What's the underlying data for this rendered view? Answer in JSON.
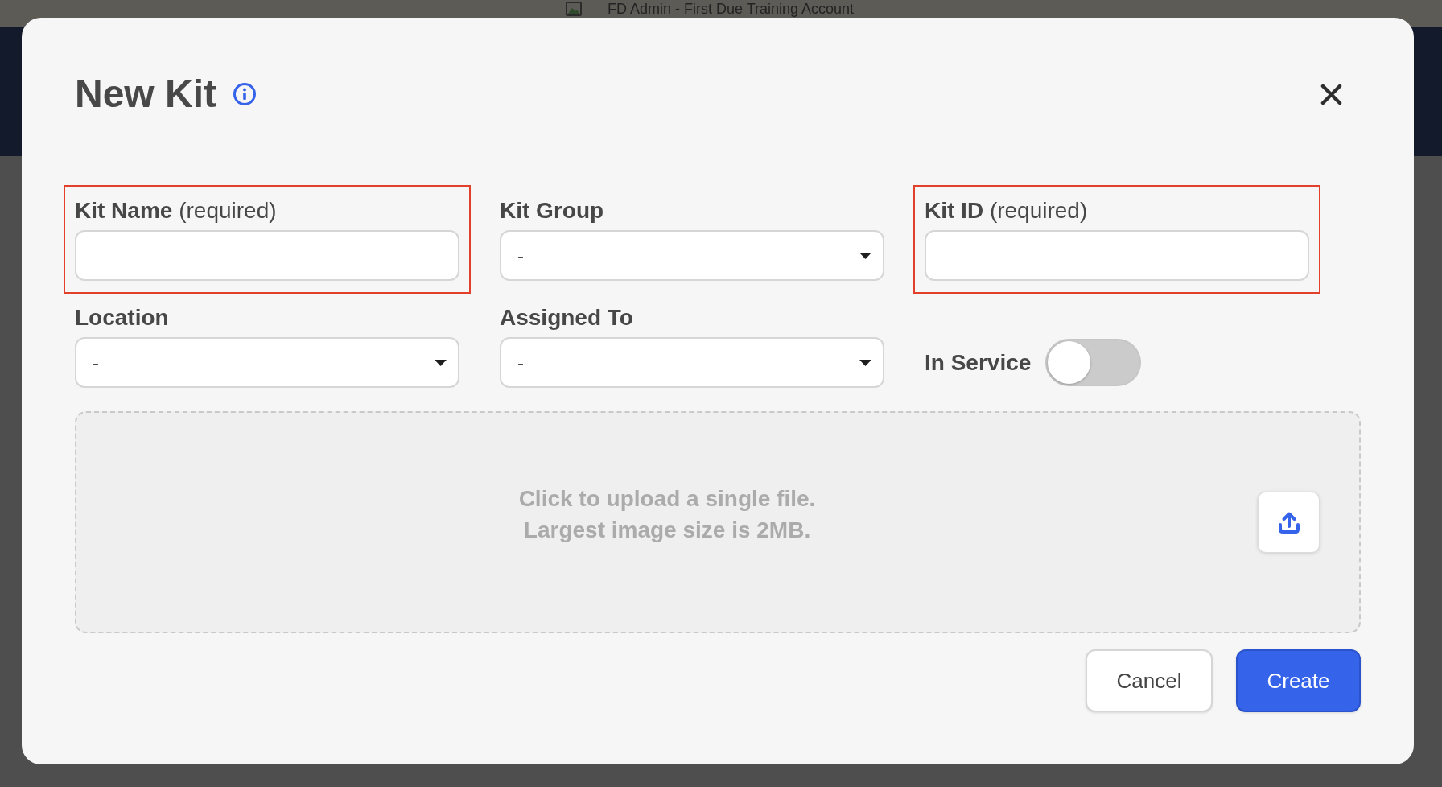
{
  "window": {
    "title": "FD Admin - First Due Training Account"
  },
  "dialog": {
    "title": "New Kit",
    "fields": [
      {
        "kind": "text",
        "label": "Kit Name",
        "note": "(required)",
        "error": true
      },
      {
        "kind": "select",
        "label": "Kit Group",
        "value": "-",
        "error": false
      },
      {
        "kind": "text",
        "label": "Kit ID",
        "note": "(required)",
        "error": true
      },
      {
        "kind": "select",
        "label": "Location",
        "value": "-",
        "error": false
      },
      {
        "kind": "select",
        "label": "Assigned To",
        "value": "-",
        "error": false
      },
      {
        "kind": "toggle",
        "label": "In Service",
        "on": false,
        "error": false
      }
    ],
    "upload": {
      "hint": [
        "Click to upload a single file.",
        "Largest image size is 2MB."
      ]
    },
    "buttons": [
      {
        "kind": "secondary",
        "label": "Cancel"
      },
      {
        "kind": "primary",
        "label": "Create"
      }
    ]
  }
}
